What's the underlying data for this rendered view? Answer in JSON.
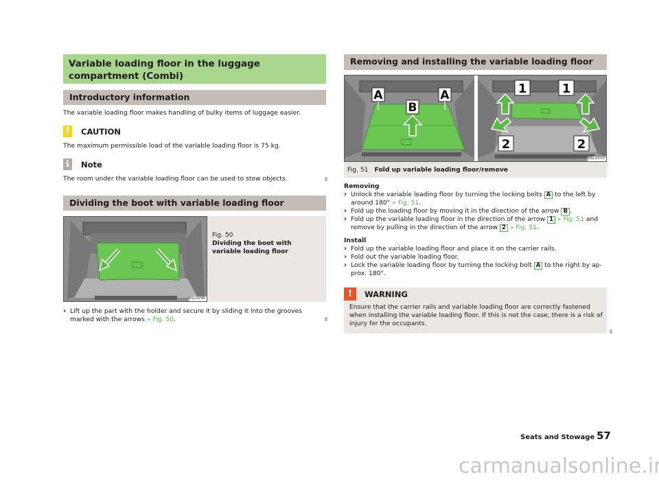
{
  "left": {
    "main_title": "Variable loading floor in the luggage compartment (Combi)",
    "intro": {
      "heading": "Introductory information",
      "text": "The variable loading floor makes handling of bulky items of luggage easier."
    },
    "caution": {
      "icon": "exclamation-icon",
      "label": "CAUTION",
      "text": "The maximum permissible load of the variable loading floor is 75 kg.",
      "color": "#f5d327"
    },
    "note": {
      "icon": "info-icon",
      "label": "Note",
      "text": "The room under the variable loading floor can be used to stow objects.",
      "color": "#b3aaa4"
    },
    "dividing": {
      "heading": "Dividing the boot with variable loading floor",
      "figure": {
        "number": "Fig. 50",
        "caption": "Dividing the boot with variable loading floor",
        "code": "B5J-0296"
      },
      "step_text": "Lift up the part with the holder and secure it by sliding it into the grooves marked with the arrows",
      "step_ref": "» Fig. 50",
      "step_end": "."
    }
  },
  "right": {
    "heading": "Removing and installing the variable loading floor",
    "figure": {
      "number": "Fig. 51",
      "caption": "Fold up variable loading floor/remove",
      "code": "B5J-0500",
      "labels_left": [
        "A",
        "A",
        "B"
      ],
      "labels_right": [
        "1",
        "1",
        "2",
        "2"
      ]
    },
    "removing": {
      "title": "Removing",
      "steps": [
        {
          "a": "Unlock the variable loading floor by turning the locking bolts",
          "key": "A",
          "b": "to the left by around 180°",
          "ref": "» Fig. 51",
          "c": "."
        },
        {
          "a": "Fold up the loading floor by moving it in the direction of the arrow",
          "key": "B",
          "c": "."
        },
        {
          "a": "Fold up the variable loading floor in the direction of the arrow",
          "key": "1",
          "ref": "» Fig. 51",
          "b": "and remove by pulling in the direction of the arrow",
          "key2": "2",
          "ref2": "» Fig. 51",
          "c": "."
        }
      ]
    },
    "install": {
      "title": "Install",
      "steps": [
        {
          "a": "Fold up the variable loading floor and place it on the carrier rails."
        },
        {
          "a": "Fold out the variable loading floor."
        },
        {
          "a": "Lock the variable loading floor by turning the locking bolt",
          "key": "A",
          "b": "to the right by ap-prox. 180°."
        }
      ]
    },
    "warning": {
      "icon": "exclamation-icon",
      "label": "WARNING",
      "text": "Ensure that the carrier rails and variable loading floor are correctly fastened when installing the variable loading floor. If this is not the case, there is a risk of injury for the occupants.",
      "color": "#e8542c"
    }
  },
  "footer": {
    "section": "Seats and Stowage",
    "page": "57"
  },
  "watermark": "carmanualsonline.info",
  "chevron": "›",
  "colors": {
    "title_green": "#a9d68d",
    "heading_grey": "#c4bcb7",
    "link_green": "#4fb14a",
    "box_beige": "#ebe8e3",
    "highlight_green": "#6cc654"
  }
}
